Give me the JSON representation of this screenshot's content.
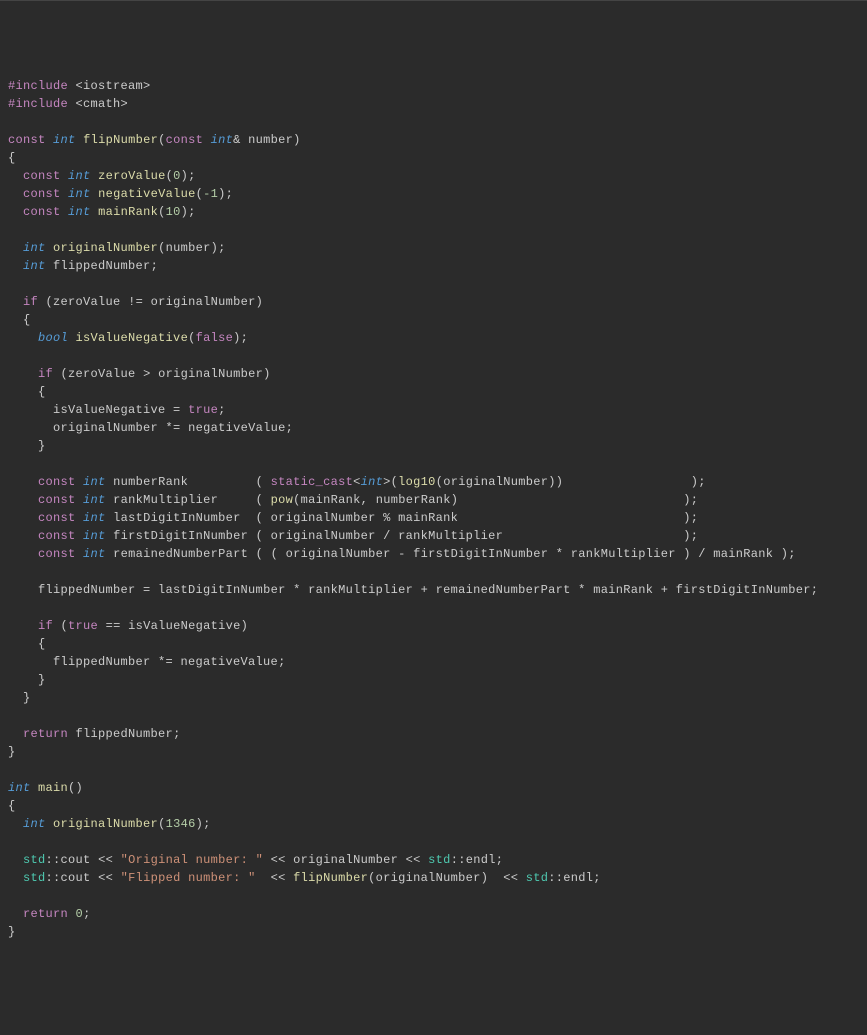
{
  "code": {
    "includes": {
      "preproc": "#include",
      "iostream": "<iostream>",
      "cmath": "<cmath>"
    },
    "kw": {
      "const": "const",
      "int": "int",
      "bool": "bool",
      "if": "if",
      "return": "return",
      "true": "true",
      "false": "false",
      "static_cast": "static_cast"
    },
    "funcs": {
      "flipNumber": "flipNumber",
      "main": "main",
      "log10": "log10",
      "pow": "pow"
    },
    "idents": {
      "number": "number",
      "zeroValue": "zeroValue",
      "negativeValue": "negativeValue",
      "mainRank": "mainRank",
      "originalNumber": "originalNumber",
      "flippedNumber": "flippedNumber",
      "isValueNegative": "isValueNegative",
      "numberRank": "numberRank",
      "rankMultiplier": "rankMultiplier",
      "lastDigitInNumber": "lastDigitInNumber",
      "firstDigitInNumber": "firstDigitInNumber",
      "remainedNumberPart": "remainedNumberPart"
    },
    "nums": {
      "zero": "0",
      "negOne": "-1",
      "ten": "10",
      "sample": "1346"
    },
    "std": {
      "std": "std",
      "cout": "cout",
      "endl": "endl"
    },
    "str": {
      "original": "\"Original number: \"",
      "flipped": "\"Flipped number: \""
    }
  }
}
